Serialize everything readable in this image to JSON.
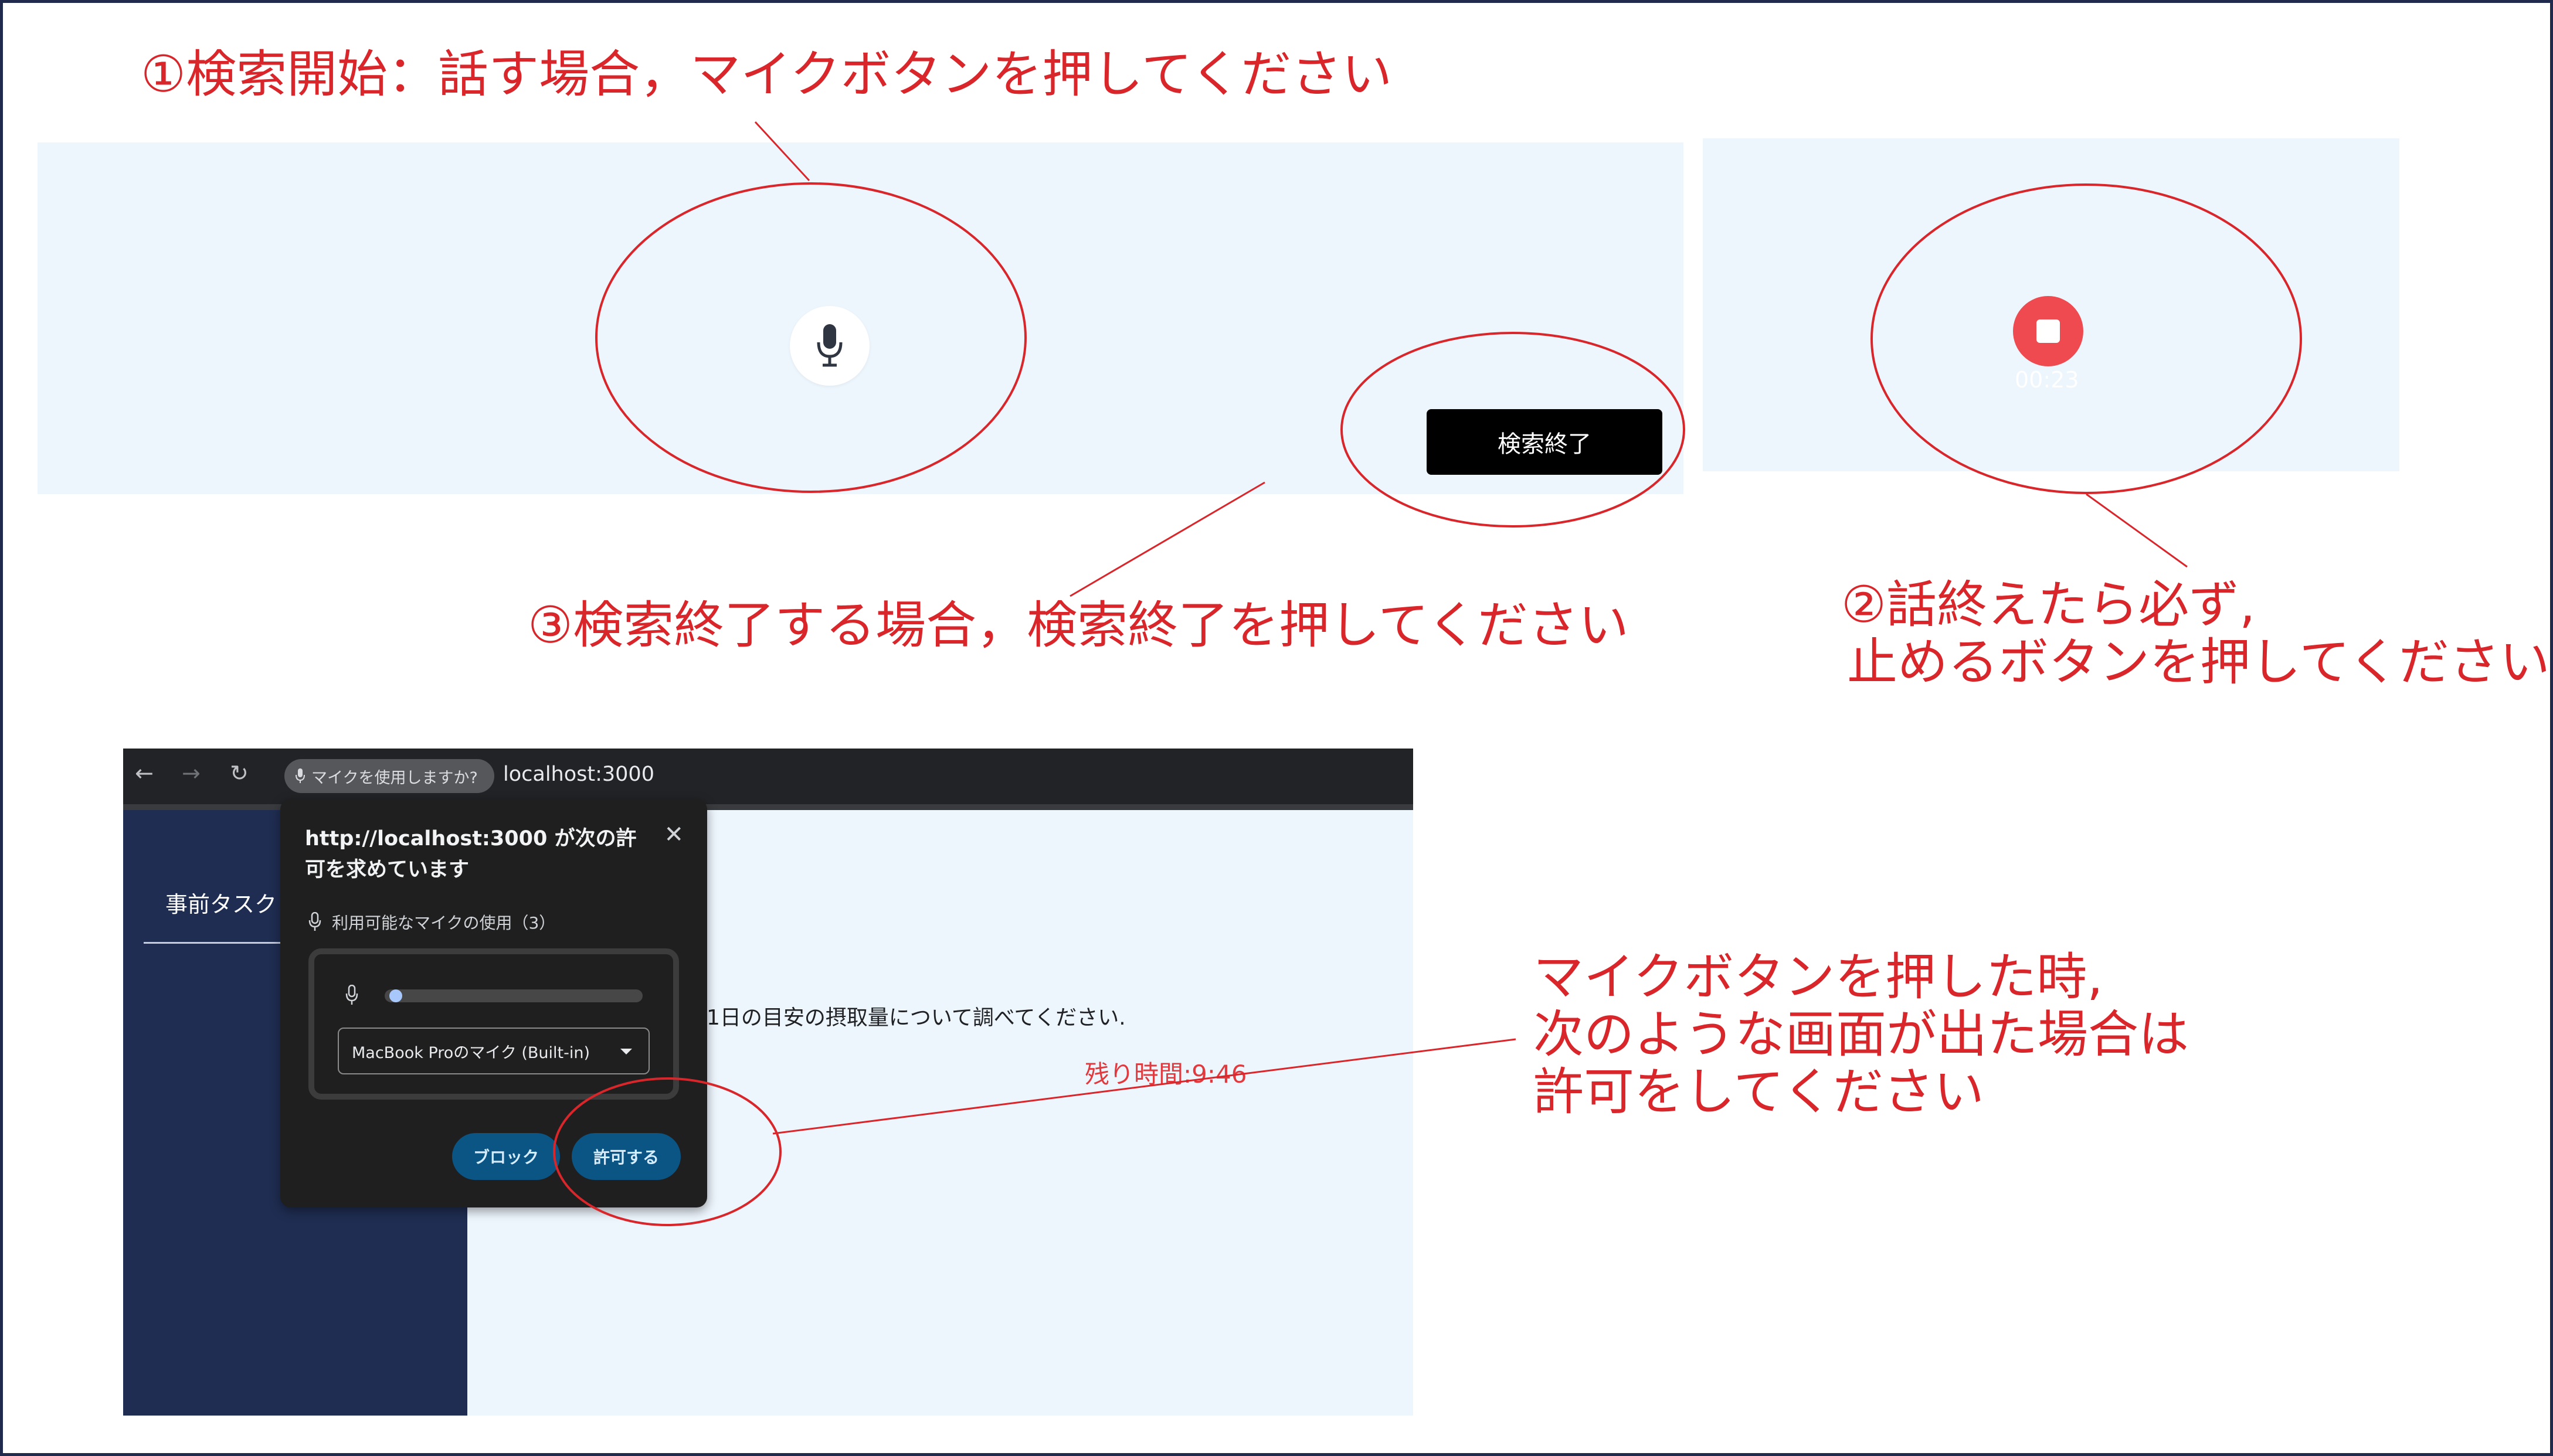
{
  "annotations": {
    "step1": "①検索開始：話す場合，マイクボタンを押してください",
    "step3": "③検索終了する場合，検索終了を押してください",
    "step2_line1": "②話終えたら必ず,",
    "step2_line2": "止めるボタンを押してください",
    "permission_line1": "マイクボタンを押した時,",
    "permission_line2": "次のような画面が出た場合は",
    "permission_line3": "許可をしてください"
  },
  "recording_panel": {
    "end_search_button": "検索終了",
    "timer": "00:23"
  },
  "browser": {
    "mic_chip": "マイクを使用しますか?",
    "url": "localhost:3000",
    "sidebar_tab": "事前タスク",
    "content_text": "1日の目安の摂取量について調べてください.",
    "remaining_time": "残り時間:9:46"
  },
  "dialog": {
    "title": "http://localhost:3000 が次の許可を求めています",
    "permission": "利用可能なマイクの使用（3）",
    "device": "MacBook Proのマイク (Built-in)",
    "block_button": "ブロック",
    "allow_button": "許可する",
    "mic_level": 0.02
  },
  "colors": {
    "annotation": "#d9262b",
    "panel_bg": "#edf5fd",
    "stop_red": "#ef4a4f",
    "sidebar": "#1f2d52",
    "dialog_button": "#0b5585"
  }
}
